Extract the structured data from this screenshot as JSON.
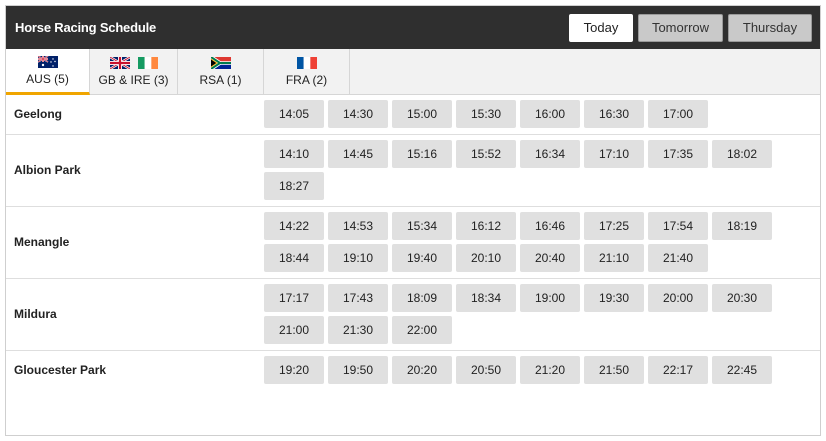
{
  "header": {
    "title": "Horse Racing Schedule",
    "days": [
      "Today",
      "Tomorrow",
      "Thursday"
    ],
    "active_day": "Today"
  },
  "tabs": [
    {
      "label": "AUS (5)",
      "flags": [
        "australia-flag-icon"
      ],
      "active": true
    },
    {
      "label": "GB & IRE (3)",
      "flags": [
        "uk-flag-icon",
        "ireland-flag-icon"
      ],
      "active": false
    },
    {
      "label": "RSA (1)",
      "flags": [
        "south-africa-flag-icon"
      ],
      "active": false
    },
    {
      "label": "FRA (2)",
      "flags": [
        "france-flag-icon"
      ],
      "active": false
    }
  ],
  "meetings": [
    {
      "venue": "Geelong",
      "times": [
        "14:05",
        "14:30",
        "15:00",
        "15:30",
        "16:00",
        "16:30",
        "17:00"
      ]
    },
    {
      "venue": "Albion Park",
      "times": [
        "14:10",
        "14:45",
        "15:16",
        "15:52",
        "16:34",
        "17:10",
        "17:35",
        "18:02",
        "18:27"
      ]
    },
    {
      "venue": "Menangle",
      "times": [
        "14:22",
        "14:53",
        "15:34",
        "16:12",
        "16:46",
        "17:25",
        "17:54",
        "18:19",
        "18:44",
        "19:10",
        "19:40",
        "20:10",
        "20:40",
        "21:10",
        "21:40"
      ]
    },
    {
      "venue": "Mildura",
      "times": [
        "17:17",
        "17:43",
        "18:09",
        "18:34",
        "19:00",
        "19:30",
        "20:00",
        "20:30",
        "21:00",
        "21:30",
        "22:00"
      ]
    },
    {
      "venue": "Gloucester Park",
      "times": [
        "19:20",
        "19:50",
        "20:20",
        "20:50",
        "21:20",
        "21:50",
        "22:17",
        "22:45"
      ]
    }
  ],
  "colors": {
    "header_bg": "#2f2f2f",
    "active_tab_underline": "#f0a500",
    "time_button_bg": "#e0e0e0"
  }
}
